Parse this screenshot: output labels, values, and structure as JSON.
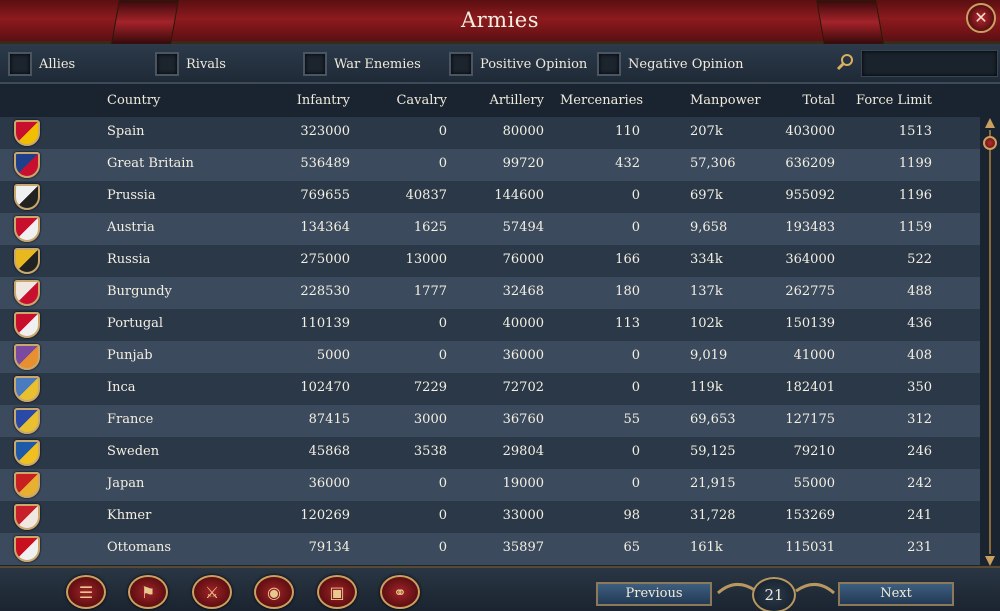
{
  "window": {
    "title": "Armies",
    "close_icon": "close-icon"
  },
  "filters": [
    {
      "label": "Allies"
    },
    {
      "label": "Rivals"
    },
    {
      "label": "War Enemies"
    },
    {
      "label": "Positive Opinion"
    },
    {
      "label": "Negative Opinion"
    }
  ],
  "search": {
    "placeholder": "",
    "value": ""
  },
  "columns": [
    "Country",
    "Infantry",
    "Cavalry",
    "Artillery",
    "Mercenaries",
    "Manpower",
    "Total",
    "Force Limit"
  ],
  "rows": [
    {
      "country": "Spain",
      "infantry": "323000",
      "cavalry": "0",
      "artillery": "80000",
      "mercenaries": "110",
      "manpower": "207k",
      "total": "403000",
      "force_limit": "1513",
      "flag_colors": [
        "#c8102e",
        "#f1bf00"
      ]
    },
    {
      "country": "Great Britain",
      "infantry": "536489",
      "cavalry": "0",
      "artillery": "99720",
      "mercenaries": "432",
      "manpower": "57,306",
      "total": "636209",
      "force_limit": "1199",
      "flag_colors": [
        "#1f3f8a",
        "#c8102e"
      ]
    },
    {
      "country": "Prussia",
      "infantry": "769655",
      "cavalry": "40837",
      "artillery": "144600",
      "mercenaries": "0",
      "manpower": "697k",
      "total": "955092",
      "force_limit": "1196",
      "flag_colors": [
        "#f0f0f0",
        "#222222"
      ]
    },
    {
      "country": "Austria",
      "infantry": "134364",
      "cavalry": "1625",
      "artillery": "57494",
      "mercenaries": "0",
      "manpower": "9,658",
      "total": "193483",
      "force_limit": "1159",
      "flag_colors": [
        "#c8102e",
        "#f0f0f0"
      ]
    },
    {
      "country": "Russia",
      "infantry": "275000",
      "cavalry": "13000",
      "artillery": "76000",
      "mercenaries": "166",
      "manpower": "334k",
      "total": "364000",
      "force_limit": "522",
      "flag_colors": [
        "#e8b820",
        "#222222"
      ]
    },
    {
      "country": "Burgundy",
      "infantry": "228530",
      "cavalry": "1777",
      "artillery": "32468",
      "mercenaries": "180",
      "manpower": "137k",
      "total": "262775",
      "force_limit": "488",
      "flag_colors": [
        "#f0e8e0",
        "#c8102e"
      ]
    },
    {
      "country": "Portugal",
      "infantry": "110139",
      "cavalry": "0",
      "artillery": "40000",
      "mercenaries": "113",
      "manpower": "102k",
      "total": "150139",
      "force_limit": "436",
      "flag_colors": [
        "#c8102e",
        "#f0f0f0"
      ]
    },
    {
      "country": "Punjab",
      "infantry": "5000",
      "cavalry": "0",
      "artillery": "36000",
      "mercenaries": "0",
      "manpower": "9,019",
      "total": "41000",
      "force_limit": "408",
      "flag_colors": [
        "#7a4aa0",
        "#e89030"
      ]
    },
    {
      "country": "Inca",
      "infantry": "102470",
      "cavalry": "7229",
      "artillery": "72702",
      "mercenaries": "0",
      "manpower": "119k",
      "total": "182401",
      "force_limit": "350",
      "flag_colors": [
        "#4a7ac0",
        "#e8c030"
      ]
    },
    {
      "country": "France",
      "infantry": "87415",
      "cavalry": "3000",
      "artillery": "36760",
      "mercenaries": "55",
      "manpower": "69,653",
      "total": "127175",
      "force_limit": "312",
      "flag_colors": [
        "#2a4aa8",
        "#e8c030"
      ]
    },
    {
      "country": "Sweden",
      "infantry": "45868",
      "cavalry": "3538",
      "artillery": "29804",
      "mercenaries": "0",
      "manpower": "59,125",
      "total": "79210",
      "force_limit": "246",
      "flag_colors": [
        "#1f5aa8",
        "#f0c020"
      ]
    },
    {
      "country": "Japan",
      "infantry": "36000",
      "cavalry": "0",
      "artillery": "19000",
      "mercenaries": "0",
      "manpower": "21,915",
      "total": "55000",
      "force_limit": "242",
      "flag_colors": [
        "#c82020",
        "#e8b030"
      ]
    },
    {
      "country": "Khmer",
      "infantry": "120269",
      "cavalry": "0",
      "artillery": "33000",
      "mercenaries": "98",
      "manpower": "31,728",
      "total": "153269",
      "force_limit": "241",
      "flag_colors": [
        "#c8202a",
        "#f0e8e0"
      ]
    },
    {
      "country": "Ottomans",
      "infantry": "79134",
      "cavalry": "0",
      "artillery": "35897",
      "mercenaries": "65",
      "manpower": "161k",
      "total": "115031",
      "force_limit": "231",
      "flag_colors": [
        "#c8101e",
        "#f0f0f0"
      ]
    }
  ],
  "bottom_tabs": [
    {
      "icon": "ledger-icon",
      "glyph": "☰"
    },
    {
      "icon": "flags-icon",
      "glyph": "⚑"
    },
    {
      "icon": "crossed-swords-icon",
      "glyph": "⚔"
    },
    {
      "icon": "coins-icon",
      "glyph": "◉"
    },
    {
      "icon": "crate-icon",
      "glyph": "▣"
    },
    {
      "icon": "handshake-icon",
      "glyph": "⚭"
    }
  ],
  "pagination": {
    "previous_label": "Previous",
    "next_label": "Next",
    "page": "21"
  }
}
